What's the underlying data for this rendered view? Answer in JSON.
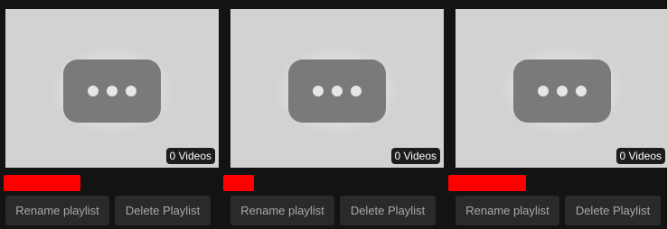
{
  "playlists": [
    {
      "video_count": "0 Videos",
      "rename_label": "Rename playlist",
      "delete_label": "Delete Playlist",
      "name_redaction_color": "#ff0000"
    },
    {
      "video_count": "0 Videos",
      "rename_label": "Rename playlist",
      "delete_label": "Delete Playlist",
      "name_redaction_color": "#ff0000"
    },
    {
      "video_count": "0 Videos",
      "rename_label": "Rename playlist",
      "delete_label": "Delete Playlist",
      "name_redaction_color": "#ff0000"
    }
  ],
  "icons": {
    "thumbnail_placeholder": "more-horizontal-icon"
  },
  "colors": {
    "background": "#131313",
    "button_bg": "#2a2a2a",
    "button_text": "#a9a9a9"
  }
}
